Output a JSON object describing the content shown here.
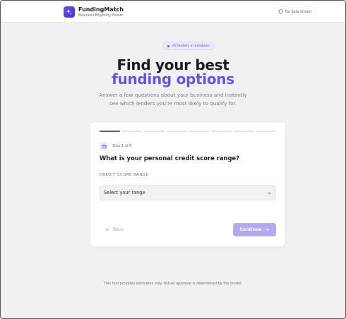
{
  "header": {
    "app_name": "FundingMatch",
    "app_subtitle": "Business Eligibility Finder",
    "privacy_label": "No data stored",
    "logo_icon": "sparkle-icon",
    "privacy_icon": "shield-icon"
  },
  "hero": {
    "badge": "All lenders in database",
    "title_line1": "Find your best",
    "title_line2": "funding options",
    "lead_line1": "Answer a few questions about your business and instantly",
    "lead_line2": "see which lenders you're most likely to qualify for."
  },
  "wizard": {
    "total_steps": 8,
    "current_step": 1,
    "step_label": "Step 1 of 8",
    "question": "What is your personal credit score range?",
    "field_label": "CREDIT SCORE RANGE",
    "select_value": "Select your range",
    "back_label": "Back",
    "continue_label": "Continue"
  },
  "footer": {
    "disclaimer": "This tool provides estimates only. Actual approval is determined by the lender."
  },
  "colors": {
    "accent": "#5b47d6",
    "accent_light": "#6a55d8",
    "continue_disabled": "#b6a9f0",
    "background": "#f1f1f3"
  }
}
